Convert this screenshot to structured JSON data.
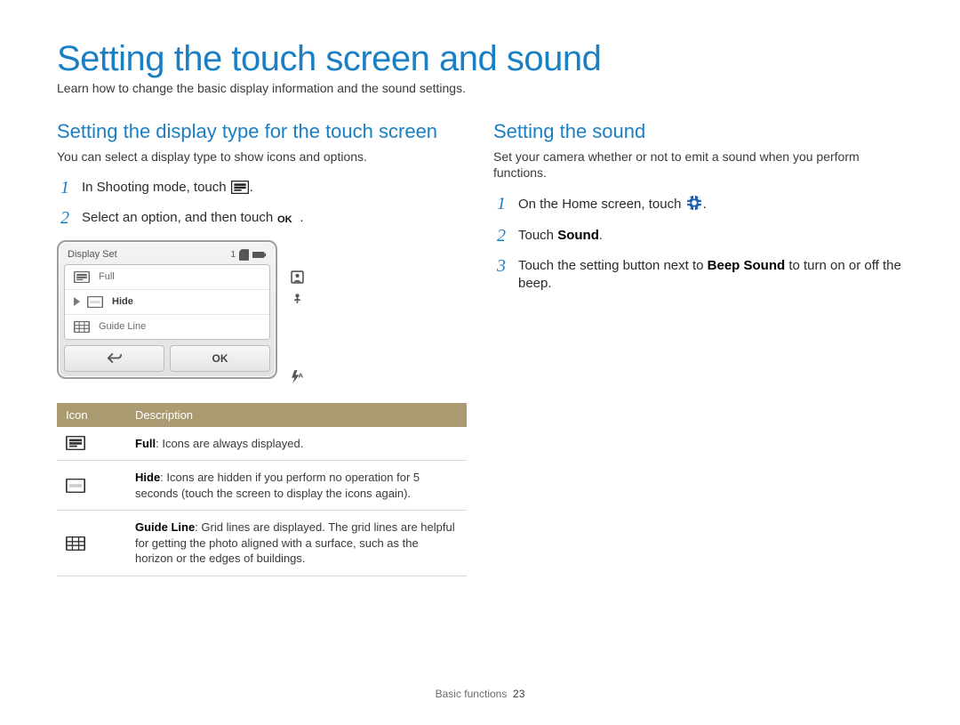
{
  "page": {
    "title": "Setting the touch screen and sound",
    "subtitle": "Learn how to change the basic display information and the sound settings."
  },
  "left": {
    "title": "Setting the display type for the touch screen",
    "subtitle": "You can select a display type to show icons and options.",
    "steps": [
      {
        "num": "1",
        "text_pre": "In Shooting mode, touch ",
        "icon": "display-full-icon",
        "text_post": "."
      },
      {
        "num": "2",
        "text_pre": "Select an option, and then touch ",
        "icon": "ok-word-icon",
        "text_post": "."
      }
    ],
    "device": {
      "header_title": "Display Set",
      "header_count": "1",
      "items": [
        {
          "icon": "display-full-icon",
          "label": "Full",
          "selected": false
        },
        {
          "icon": "display-hide-icon",
          "label": "Hide",
          "selected": true
        },
        {
          "icon": "display-grid-icon",
          "label": "Guide Line",
          "selected": false
        }
      ],
      "ok_label": "OK"
    },
    "table": {
      "head_icon": "Icon",
      "head_desc": "Description",
      "rows": [
        {
          "icon": "display-full-icon",
          "lead": "Full",
          "body": ": Icons are always displayed."
        },
        {
          "icon": "display-hide-icon",
          "lead": "Hide",
          "body": ": Icons are hidden if you perform no operation for 5 seconds (touch the screen to display the icons again)."
        },
        {
          "icon": "display-grid-icon",
          "lead": "Guide Line",
          "body": ": Grid lines are displayed. The grid lines are helpful for getting the photo aligned with a surface, such as the horizon or the edges of buildings."
        }
      ]
    }
  },
  "right": {
    "title": "Setting the sound",
    "subtitle": "Set your camera whether or not to emit a sound when you perform functions.",
    "steps": [
      {
        "num": "1",
        "text_pre": "On the Home screen, touch ",
        "icon": "gear-blue-icon",
        "text_post": "."
      },
      {
        "num": "2",
        "text_pre": "Touch ",
        "bold": "Sound",
        "text_post": "."
      },
      {
        "num": "3",
        "text_pre": "Touch the setting button next to ",
        "bold": "Beep Sound",
        "text_post": " to turn on or off the beep."
      }
    ]
  },
  "footer": {
    "section": "Basic functions",
    "page_no": "23"
  },
  "icons": {
    "display-full-icon": "display-full",
    "display-hide-icon": "display-hide",
    "display-grid-icon": "display-grid",
    "ok-word-icon": "ok-word",
    "gear-blue-icon": "gear-blue",
    "back-arrow-icon": "back-arrow",
    "sd-icon": "sd",
    "battery-icon": "battery",
    "portrait-icon": "portrait",
    "macro-icon": "macro",
    "flash-auto-icon": "flash-auto"
  }
}
